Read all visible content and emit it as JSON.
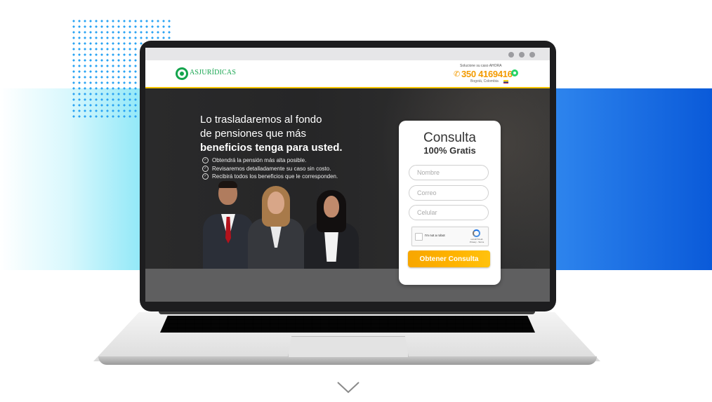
{
  "site": {
    "logo_text": "ASJURÍDICAS",
    "logo_tagline": "",
    "header_small": "Solucione su caso AHORA",
    "phone": "350 4169416",
    "location": "Bogotá, Colombia"
  },
  "hero": {
    "headline_line1": "Lo trasladaremos al fondo",
    "headline_line2": "de pensiones que más",
    "headline_line3": "beneficios tenga para usted.",
    "bullets": [
      "Obtendrá la pensión más alta posible.",
      "Revisaremos detalladamente su caso sin costo.",
      "Recibirá todos los beneficios que le corresponden."
    ]
  },
  "form": {
    "title": "Consulta",
    "subtitle": "100% Gratis",
    "name_placeholder": "Nombre",
    "email_placeholder": "Correo",
    "phone_placeholder": "Celular",
    "captcha_label": "I'm not a robot",
    "captcha_brand": "reCAPTCHA",
    "captcha_links": "Privacy - Terms",
    "submit_label": "Obtener Consulta"
  },
  "colors": {
    "accent_orange": "#f39b00",
    "brand_green": "#14a44d",
    "band_blue": "#0a5ad9",
    "band_cyan": "#88e6f7"
  },
  "icons": [
    "phone-icon",
    "whatsapp-icon",
    "check-circle-icon",
    "chevron-down-icon",
    "recaptcha-icon"
  ]
}
